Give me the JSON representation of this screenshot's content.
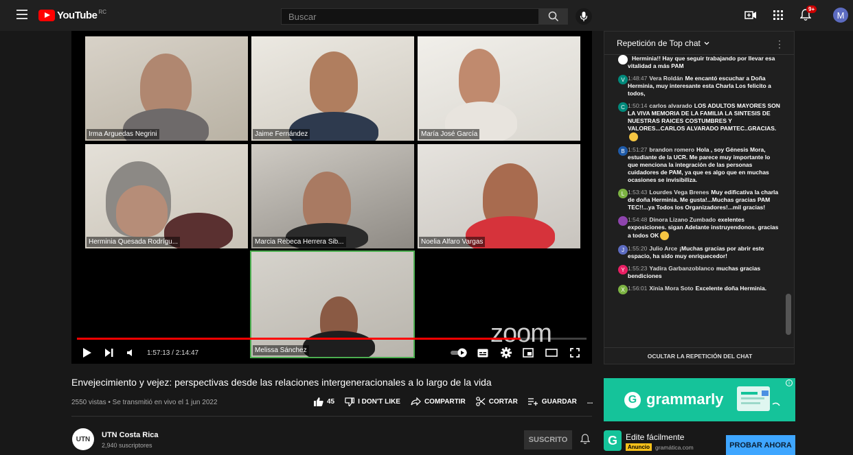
{
  "header": {
    "logo_text": "YouTube",
    "region": "RC",
    "search_placeholder": "Buscar",
    "notification_count": "9+",
    "avatar_letter": "M"
  },
  "player": {
    "participants": [
      {
        "name": "Irma Arguedas Negrini"
      },
      {
        "name": "Jaime Fernández"
      },
      {
        "name": "María José García"
      },
      {
        "name": "Herminia Quesada Rodrígu..."
      },
      {
        "name": "Marcia Rebeca Herrera Sib..."
      },
      {
        "name": "Noelia Alfaro Vargas"
      },
      {
        "name": "Melissa Sánchez"
      }
    ],
    "zoom_watermark": "zoom",
    "time_display": "1:57:13 / 2:14:47",
    "progress_fraction": 0.871
  },
  "video": {
    "title": "Envejecimiento y vejez: perspectivas desde las relaciones intergeneracionales a lo largo de la vida",
    "meta": "2550 vistas • Se transmitió en vivo el 1 jun 2022",
    "like_count": "45",
    "dislike_label": "I DON'T LIKE",
    "share_label": "COMPARTIR",
    "clip_label": "CORTAR",
    "save_label": "GUARDAR",
    "more_label": "..."
  },
  "channel": {
    "avatar_text": "UTN",
    "name": "UTN Costa Rica",
    "subscribers": "2,940 suscriptores",
    "subscribed_label": "SUSCRITO"
  },
  "chat": {
    "header": "Repetición de Top chat",
    "footer": "OCULTAR LA REPETICIÓN DEL CHAT",
    "messages": [
      {
        "ts": "",
        "author": "",
        "text": "Herminia!! Hay que seguir trabajando por llevar esa vitalidad a más PAM",
        "initial": "",
        "color": "#ffffff"
      },
      {
        "ts": "1:48:47",
        "author": "Vera Roldán",
        "text": "Me encantó escuchar a Doña Herminia, muy interesante esta Charla Los felicito a todos,",
        "initial": "V",
        "color": "#00897b"
      },
      {
        "ts": "1:50:14",
        "author": "carlos alvarado",
        "text": "LOS ADULTOS MAYORES SON LA VIVA MEMORIA DE LA FAMILIA LA SINTESIS DE NUESTRAS RAICES COSTUMBRES Y VALORES...CARLOS ALVARADO PAMTEC..GRACIAS.",
        "initial": "C",
        "color": "#00897b"
      },
      {
        "ts": "1:51:27",
        "author": "brandon romero",
        "text": "Hola , soy Génesis Mora, estudiante de la UCR. Me parece muy importante lo que menciona la integración de las personas cuidadores de PAM, ya que es algo que en muchas ocasiones se invisibiliza.",
        "initial": "B",
        "color": "#1e5aa8"
      },
      {
        "ts": "1:53:43",
        "author": "Lourdes Vega Brenes",
        "text": "Muy edificativa la charla de doña Herminia. Me gusta!...Muchas gracias PAM TEC!!...ya Todos los Organizadores!...mil gracias!",
        "initial": "L",
        "color": "#7cb342"
      },
      {
        "ts": "1:54:48",
        "author": "Dinora Lizano Zumbado",
        "text": "exelentes exposiciones. sigan Adelante instruyendonos. gracias a todos OK",
        "initial": "",
        "color": "#8e44ad"
      },
      {
        "ts": "1:55:20",
        "author": "Julio Arce",
        "text": "¡Muchas gracias por abrir este espacio, ha sido muy enriquecedor!",
        "initial": "J",
        "color": "#5c6bc0"
      },
      {
        "ts": "1:55:23",
        "author": "Yadira Garbanzoblanco",
        "text": "muchas gracias bendiciones",
        "initial": "Y",
        "color": "#e91e63"
      },
      {
        "ts": "1:56:01",
        "author": "Xinia Mora Soto",
        "text": "Excelente doña Herminia.",
        "initial": "X",
        "color": "#7cb342"
      }
    ]
  },
  "ads": {
    "banner_brand": "grammarly",
    "banner_initial": "G",
    "card_initial": "G",
    "card_title": "Edite fácilmente",
    "card_tag": "Anuncio",
    "card_domain": "gramática.com",
    "cta_label": "PROBAR AHORA"
  }
}
